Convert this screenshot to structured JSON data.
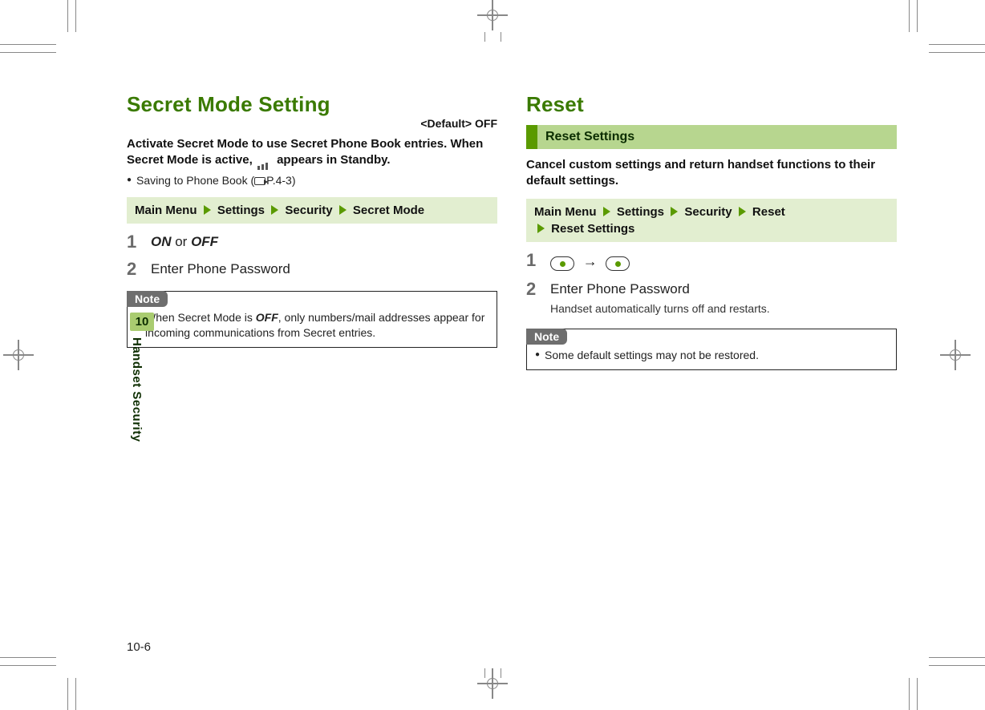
{
  "meta": {
    "chapter_number": "10",
    "chapter_title": "Handset Security",
    "page_number": "10-6"
  },
  "left": {
    "heading": "Secret Mode Setting",
    "default_tag": "<Default> OFF",
    "intro_part1": "Activate Secret Mode to use Secret Phone Book entries. When Secret Mode is active, ",
    "intro_part2": " appears in Standby.",
    "bullet": "Saving to Phone Book (",
    "bullet_ref": "P.4-3)",
    "nav": [
      "Main Menu",
      "Settings",
      "Security",
      "Secret Mode"
    ],
    "steps": [
      {
        "num": "1",
        "rich": true,
        "on": "ON",
        "or": " or ",
        "off": "OFF"
      },
      {
        "num": "2",
        "text": "Enter Phone Password"
      }
    ],
    "note_label": "Note",
    "note_text_pre": "When Secret Mode is ",
    "note_text_bold": "OFF",
    "note_text_post": ", only numbers/mail addresses appear for incoming communications from Secret entries."
  },
  "right": {
    "heading": "Reset",
    "section": "Reset Settings",
    "intro": "Cancel custom settings and return handset functions to their default settings.",
    "nav_line1": [
      "Main Menu",
      "Settings",
      "Security",
      "Reset"
    ],
    "nav_line2": [
      "Reset Settings"
    ],
    "steps": [
      {
        "num": "1",
        "buttons": true
      },
      {
        "num": "2",
        "text": "Enter Phone Password",
        "sub": "Handset automatically turns off and restarts."
      }
    ],
    "note_label": "Note",
    "note_text": "Some default settings may not be restored."
  }
}
